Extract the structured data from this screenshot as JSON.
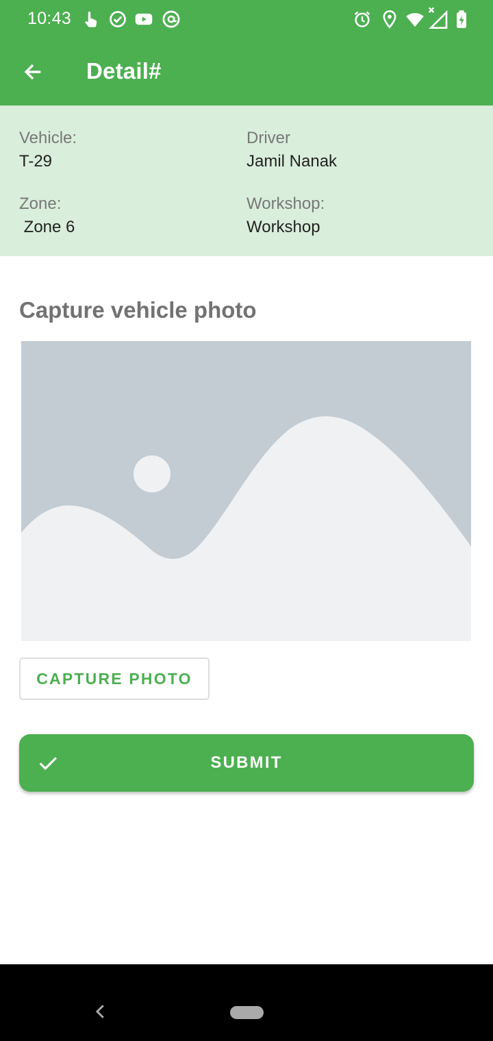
{
  "status_bar": {
    "time": "10:43",
    "icons": [
      "touch-icon",
      "check-circle-icon",
      "youtube-icon",
      "at-sign-icon",
      "alarm-icon",
      "location-icon",
      "wifi-icon",
      "signal-icon",
      "battery-icon"
    ]
  },
  "app_bar": {
    "title": "Detail#",
    "back_icon": "arrow-left-icon"
  },
  "info": {
    "vehicle_label": "Vehicle:",
    "vehicle_value": "T-29",
    "driver_label": "Driver",
    "driver_value": "Jamil Nanak",
    "zone_label": "Zone:",
    "zone_value": " Zone 6",
    "workshop_label": "Workshop:",
    "workshop_value": "Workshop"
  },
  "photo": {
    "section_title": "Capture vehicle photo",
    "placeholder_icon": "image-placeholder-icon"
  },
  "buttons": {
    "capture_label": "CAPTURE PHOTO",
    "submit_label": "SUBMIT",
    "submit_icon": "check-icon"
  },
  "colors": {
    "primary": "#4caf50",
    "info_background": "#d9eedb",
    "placeholder_sky": "#c3cbd3",
    "placeholder_hills": "#f0f1f3"
  }
}
